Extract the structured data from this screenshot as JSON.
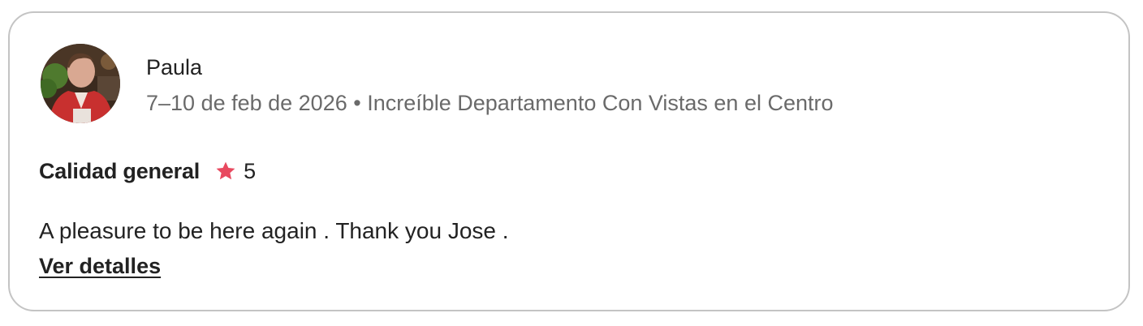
{
  "review": {
    "reviewer_name": "Paula",
    "stay_meta": "7–10 de feb de 2026 • Increíble Departamento Con Vistas en el Centro",
    "rating_label": "Calidad general",
    "rating_icon": "star-icon",
    "rating_value": "5",
    "text": "A pleasure to be here again . Thank you Jose .",
    "details_link": "Ver detalles"
  },
  "colors": {
    "text_primary": "#222222",
    "text_secondary": "#6a6a6a",
    "star": "#e8495f",
    "card_border": "#c4c4c4"
  }
}
